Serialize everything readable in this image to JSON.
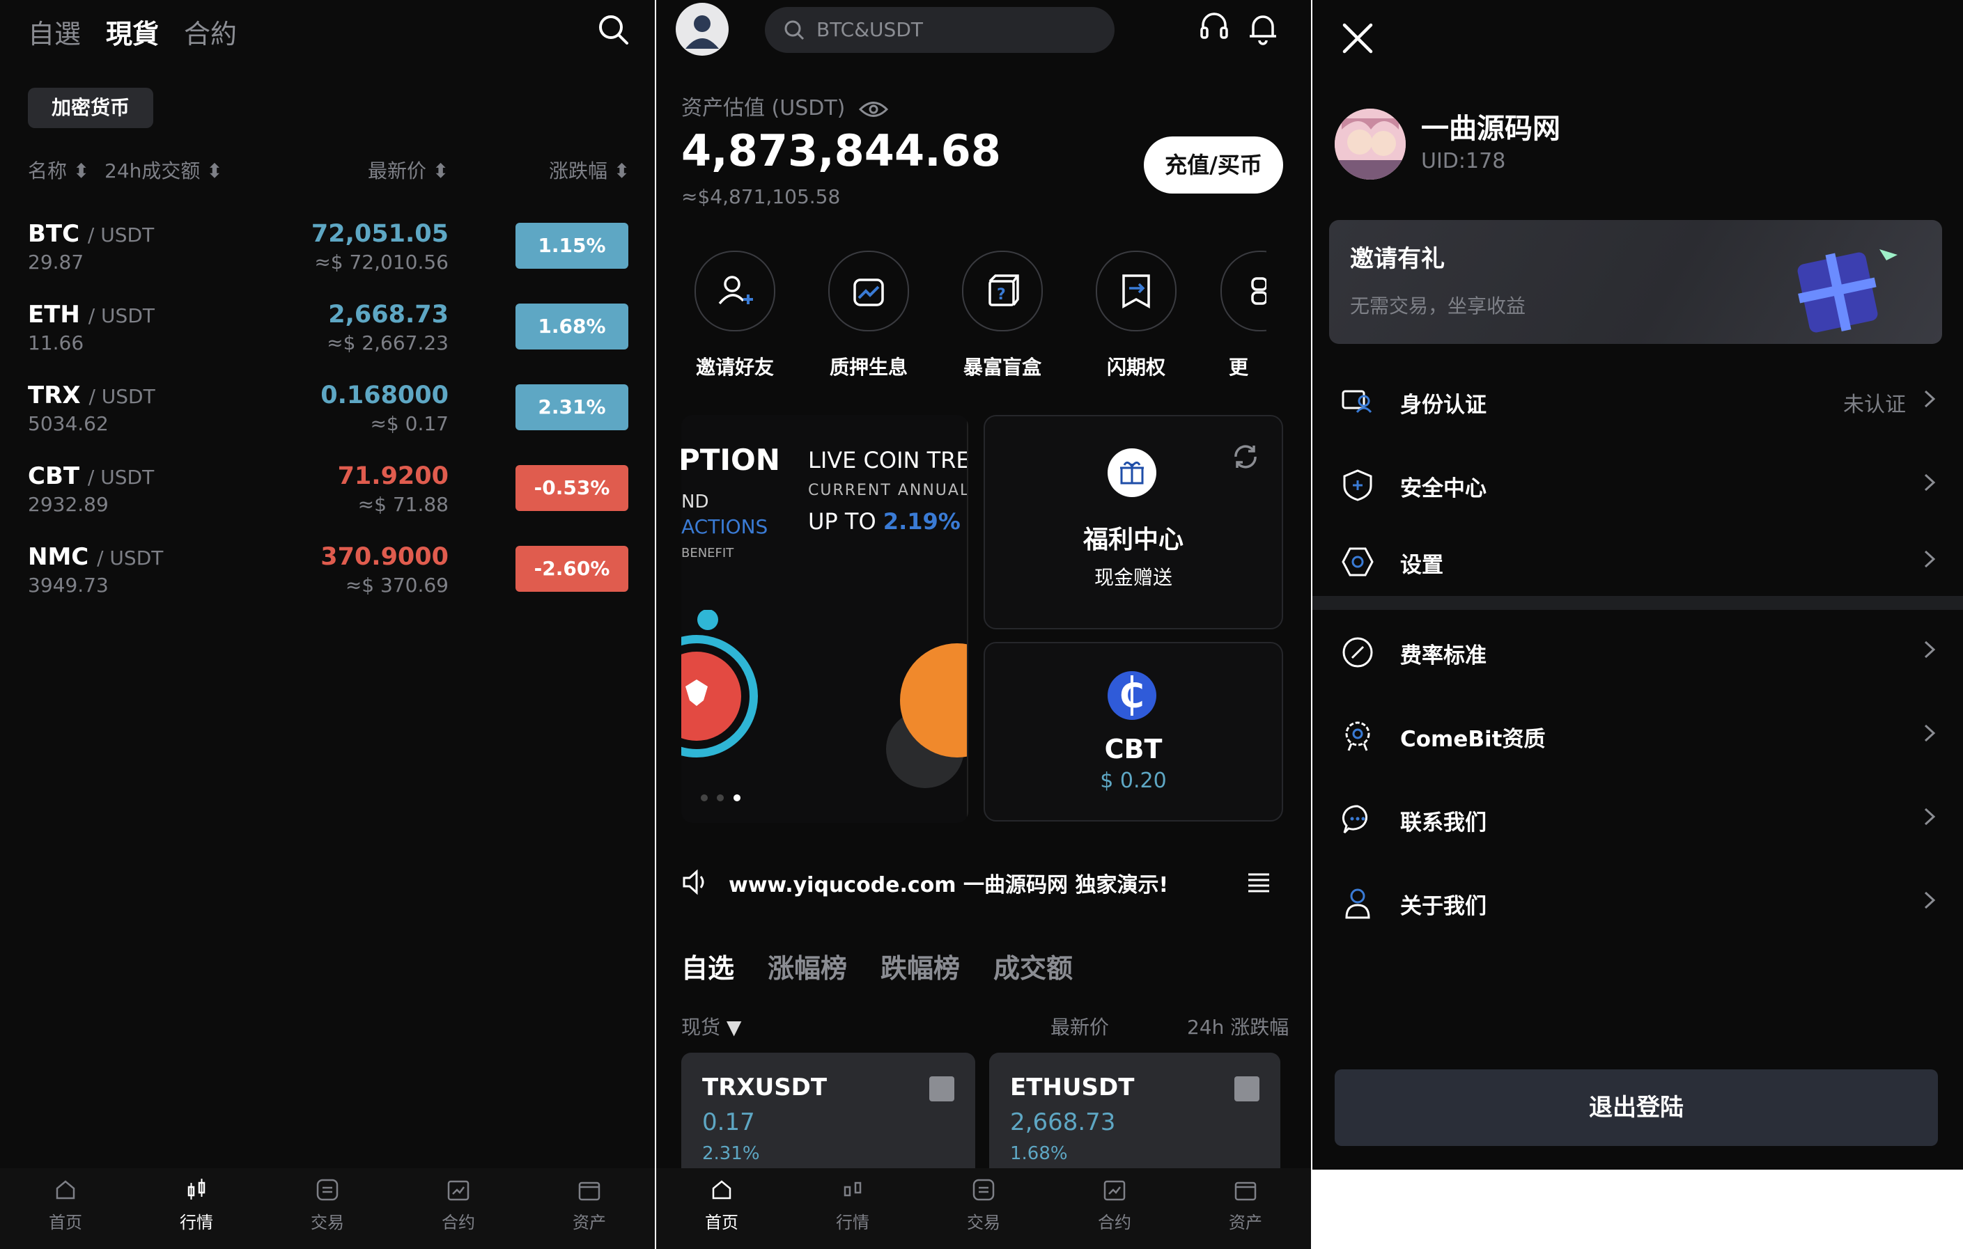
{
  "markets": {
    "tabs": [
      "自選",
      "現貨",
      "合約"
    ],
    "active_tab": 1,
    "category_chip": "加密货币",
    "headers": {
      "name": "名称",
      "volume": "24h成交额",
      "price": "最新价",
      "change": "涨跌幅"
    },
    "rows": [
      {
        "base": "BTC",
        "quote": "/ USDT",
        "volume": "29.87",
        "price": "72,051.05",
        "usd": "≈$ 72,010.56",
        "change": "1.15%",
        "dir": "up"
      },
      {
        "base": "ETH",
        "quote": "/ USDT",
        "volume": "11.66",
        "price": "2,668.73",
        "usd": "≈$ 2,667.23",
        "change": "1.68%",
        "dir": "up"
      },
      {
        "base": "TRX",
        "quote": "/ USDT",
        "volume": "5034.62",
        "price": "0.168000",
        "usd": "≈$ 0.17",
        "change": "2.31%",
        "dir": "up"
      },
      {
        "base": "CBT",
        "quote": "/ USDT",
        "volume": "2932.89",
        "price": "71.9200",
        "usd": "≈$ 71.88",
        "change": "-0.53%",
        "dir": "down"
      },
      {
        "base": "NMC",
        "quote": "/ USDT",
        "volume": "3949.73",
        "price": "370.9000",
        "usd": "≈$ 370.69",
        "change": "-2.60%",
        "dir": "down"
      }
    ]
  },
  "bottom_nav": [
    "首页",
    "行情",
    "交易",
    "合约",
    "资产"
  ],
  "home": {
    "search_placeholder": "BTC&USDT",
    "asset_label": "资产估值 (USDT)",
    "asset_value": "4,873,844.68",
    "asset_usd": "≈$4,871,105.58",
    "deposit_button": "充值/买币",
    "quick_actions": [
      "邀请好友",
      "质押生息",
      "暴富盲盒",
      "闪期权",
      "更"
    ],
    "banner": {
      "title_partial": "PTION",
      "sub_a": "ND",
      "sub_b": "ACTIONS",
      "sub_c": "BENEFIT",
      "live_title": "LIVE COIN TRE",
      "current_annual": "CURRENT ANNUAL",
      "up_to": "UP TO",
      "rate": "2.19%"
    },
    "welfare": {
      "title": "福利中心",
      "subtitle": "现金赠送"
    },
    "cbt_card": {
      "name": "CBT",
      "price": "$ 0.20"
    },
    "notice": "www.yiqucode.com 一曲源码网 独家演示!",
    "watch_tabs": [
      "自选",
      "涨幅榜",
      "跌幅榜",
      "成交额"
    ],
    "spot_label": "现货",
    "col_latest": "最新价",
    "col_change": "24h 涨跌幅",
    "cards": [
      {
        "symbol": "TRXUSDT",
        "price": "0.17",
        "change": "2.31%"
      },
      {
        "symbol": "ETHUSDT",
        "price": "2,668.73",
        "change": "1.68%"
      }
    ]
  },
  "profile": {
    "name": "一曲源码网",
    "uid": "UID:178",
    "invite": {
      "title": "邀请有礼",
      "subtitle": "无需交易，坐享收益"
    },
    "menu": [
      {
        "label": "身份认证",
        "extra": "未认证"
      },
      {
        "label": "安全中心"
      },
      {
        "label": "设置"
      },
      {
        "label": "费率标准"
      },
      {
        "label": "ComeBit资质"
      },
      {
        "label": "联系我们"
      },
      {
        "label": "关于我们"
      }
    ],
    "logout": "退出登陆"
  },
  "colors": {
    "up": "#5ea7c4",
    "down": "#e05c4e",
    "accent_blue": "#3a7bd5"
  }
}
